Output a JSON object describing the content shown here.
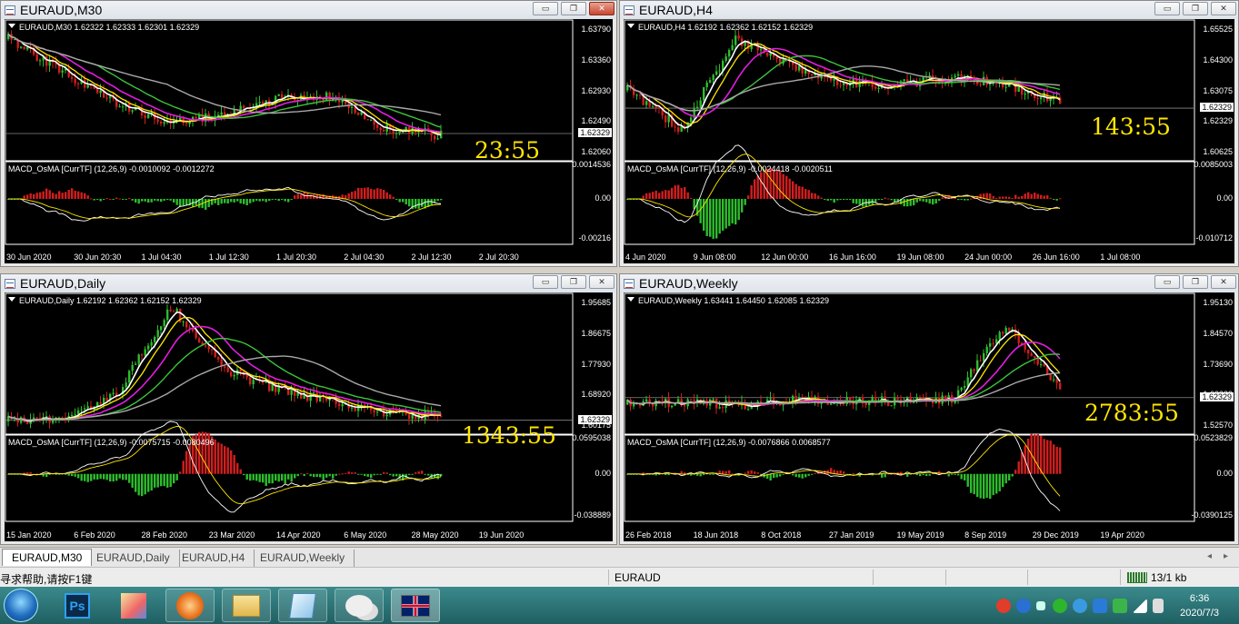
{
  "windows": [
    {
      "id": "m30",
      "title": "EURAUD,M30",
      "active": true,
      "info": "EURAUD,M30  1.62322 1.62333 1.62301 1.62329",
      "prices": [
        "1.63790",
        "1.63360",
        "1.62930",
        "1.62490",
        "1.62060"
      ],
      "current_price": "1.62329",
      "countdown": "23:55",
      "macd_info": "MACD_OsMA [CurrTF] (12,26,9) -0.0010092 -0.0012272",
      "macd_levels": [
        "0.0014536",
        "0.00",
        "-0.00216"
      ],
      "dates": [
        "30 Jun 2020",
        "30 Jun 20:30",
        "1 Jul 04:30",
        "1 Jul 12:30",
        "1 Jul 20:30",
        "2 Jul 04:30",
        "2 Jul 12:30",
        "2 Jul 20:30"
      ]
    },
    {
      "id": "h4",
      "title": "EURAUD,H4",
      "active": false,
      "info": "EURAUD,H4  1.62192 1.62362 1.62152 1.62329",
      "prices": [
        "1.65525",
        "1.64300",
        "1.63075",
        "1.62329",
        "1.60625"
      ],
      "current_price": "1.62329",
      "countdown": "143:55",
      "macd_info": "MACD_OsMA [CurrTF] (12,26,9) -0.0024418 -0.0020511",
      "macd_levels": [
        "0.0085003",
        "0.00",
        "-0.010712"
      ],
      "dates": [
        "4 Jun 2020",
        "9 Jun 08:00",
        "12 Jun 00:00",
        "16 Jun 16:00",
        "19 Jun 08:00",
        "24 Jun 00:00",
        "26 Jun 16:00",
        "1 Jul 08:00"
      ]
    },
    {
      "id": "daily",
      "title": "EURAUD,Daily",
      "active": false,
      "info": "EURAUD,Daily  1.62192 1.62362 1.62152 1.62329",
      "prices": [
        "1.95685",
        "1.86675",
        "1.77930",
        "1.68920",
        "1.60175"
      ],
      "current_price": "1.62329",
      "countdown": "1343:55",
      "macd_info": "MACD_OsMA [CurrTF] (12,26,9) -0.0075715 -0.0080496",
      "macd_levels": [
        "0.0595038",
        "0.00",
        "-0.038889"
      ],
      "dates": [
        "15 Jan 2020",
        "6 Feb 2020",
        "28 Feb 2020",
        "23 Mar 2020",
        "14 Apr 2020",
        "6 May 2020",
        "28 May 2020",
        "19 Jun 2020"
      ]
    },
    {
      "id": "weekly",
      "title": "EURAUD,Weekly",
      "active": false,
      "info": "EURAUD,Weekly  1.63441 1.64450 1.62085 1.62329",
      "prices": [
        "1.95130",
        "1.84570",
        "1.73690",
        "1.62329",
        "1.52570"
      ],
      "current_price": "1.62329",
      "countdown": "2783:55",
      "macd_info": "MACD_OsMA [CurrTF] (12,26,9) -0.0076866 0.0068577",
      "macd_levels": [
        "0.0523829",
        "0.00",
        "-0.0390125"
      ],
      "dates": [
        "26 Feb 2018",
        "18 Jun 2018",
        "8 Oct 2018",
        "27 Jan 2019",
        "19 May 2019",
        "8 Sep 2019",
        "29 Dec 2019",
        "19 Apr 2020"
      ]
    }
  ],
  "window_buttons": {
    "minimize": "▭",
    "restore": "❐",
    "close": "✕"
  },
  "tabs": [
    {
      "label": "EURAUD,M30",
      "active": true
    },
    {
      "label": "EURAUD,Daily",
      "active": false
    },
    {
      "label": "EURAUD,H4",
      "active": false
    },
    {
      "label": "EURAUD,Weekly",
      "active": false
    }
  ],
  "tab_arrows": {
    "left": "◂",
    "right": "▸"
  },
  "status": {
    "help": "寻求帮助,请按F1键",
    "symbol": "EURAUD",
    "traffic": "13/1 kb"
  },
  "taskbar": {
    "apps": [
      "start-orb",
      "photoshop",
      "chart-app",
      "360-browser",
      "file-explorer",
      "notepad",
      "wechat",
      "metatrader-uk"
    ],
    "ps_label": "Ps"
  },
  "tray": {
    "time": "6:36",
    "date": "2020/7/3"
  },
  "colors": {
    "bull": "#2dbd2d",
    "bear": "#d21e1e",
    "ma_white": "#ffffff",
    "ma_yellow": "#ffe600",
    "ma_magenta": "#e21de0",
    "ma_green": "#3cc43c",
    "ma_gray": "#a8a8a8",
    "countdown": "#ffe600"
  }
}
